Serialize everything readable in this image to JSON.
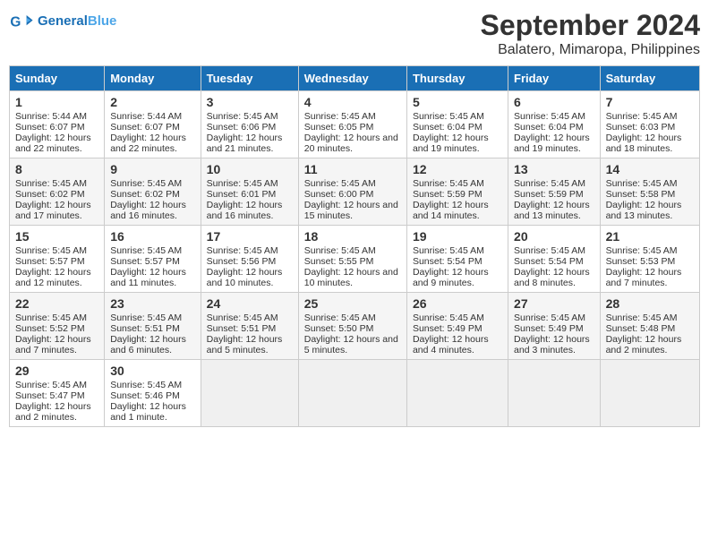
{
  "header": {
    "logo_text_general": "General",
    "logo_text_blue": "Blue",
    "title": "September 2024",
    "subtitle": "Balatero, Mimaropa, Philippines"
  },
  "calendar": {
    "days_of_week": [
      "Sunday",
      "Monday",
      "Tuesday",
      "Wednesday",
      "Thursday",
      "Friday",
      "Saturday"
    ],
    "weeks": [
      [
        {
          "day": "",
          "empty": true
        },
        {
          "day": "",
          "empty": true
        },
        {
          "day": "",
          "empty": true
        },
        {
          "day": "",
          "empty": true
        },
        {
          "day": "",
          "empty": true
        },
        {
          "day": "",
          "empty": true
        },
        {
          "day": "",
          "empty": true
        }
      ],
      [
        {
          "day": "1",
          "sunrise": "Sunrise: 5:44 AM",
          "sunset": "Sunset: 6:07 PM",
          "daylight": "Daylight: 12 hours and 22 minutes."
        },
        {
          "day": "2",
          "sunrise": "Sunrise: 5:44 AM",
          "sunset": "Sunset: 6:07 PM",
          "daylight": "Daylight: 12 hours and 22 minutes."
        },
        {
          "day": "3",
          "sunrise": "Sunrise: 5:45 AM",
          "sunset": "Sunset: 6:06 PM",
          "daylight": "Daylight: 12 hours and 21 minutes."
        },
        {
          "day": "4",
          "sunrise": "Sunrise: 5:45 AM",
          "sunset": "Sunset: 6:05 PM",
          "daylight": "Daylight: 12 hours and 20 minutes."
        },
        {
          "day": "5",
          "sunrise": "Sunrise: 5:45 AM",
          "sunset": "Sunset: 6:04 PM",
          "daylight": "Daylight: 12 hours and 19 minutes."
        },
        {
          "day": "6",
          "sunrise": "Sunrise: 5:45 AM",
          "sunset": "Sunset: 6:04 PM",
          "daylight": "Daylight: 12 hours and 19 minutes."
        },
        {
          "day": "7",
          "sunrise": "Sunrise: 5:45 AM",
          "sunset": "Sunset: 6:03 PM",
          "daylight": "Daylight: 12 hours and 18 minutes."
        }
      ],
      [
        {
          "day": "8",
          "sunrise": "Sunrise: 5:45 AM",
          "sunset": "Sunset: 6:02 PM",
          "daylight": "Daylight: 12 hours and 17 minutes."
        },
        {
          "day": "9",
          "sunrise": "Sunrise: 5:45 AM",
          "sunset": "Sunset: 6:02 PM",
          "daylight": "Daylight: 12 hours and 16 minutes."
        },
        {
          "day": "10",
          "sunrise": "Sunrise: 5:45 AM",
          "sunset": "Sunset: 6:01 PM",
          "daylight": "Daylight: 12 hours and 16 minutes."
        },
        {
          "day": "11",
          "sunrise": "Sunrise: 5:45 AM",
          "sunset": "Sunset: 6:00 PM",
          "daylight": "Daylight: 12 hours and 15 minutes."
        },
        {
          "day": "12",
          "sunrise": "Sunrise: 5:45 AM",
          "sunset": "Sunset: 5:59 PM",
          "daylight": "Daylight: 12 hours and 14 minutes."
        },
        {
          "day": "13",
          "sunrise": "Sunrise: 5:45 AM",
          "sunset": "Sunset: 5:59 PM",
          "daylight": "Daylight: 12 hours and 13 minutes."
        },
        {
          "day": "14",
          "sunrise": "Sunrise: 5:45 AM",
          "sunset": "Sunset: 5:58 PM",
          "daylight": "Daylight: 12 hours and 13 minutes."
        }
      ],
      [
        {
          "day": "15",
          "sunrise": "Sunrise: 5:45 AM",
          "sunset": "Sunset: 5:57 PM",
          "daylight": "Daylight: 12 hours and 12 minutes."
        },
        {
          "day": "16",
          "sunrise": "Sunrise: 5:45 AM",
          "sunset": "Sunset: 5:57 PM",
          "daylight": "Daylight: 12 hours and 11 minutes."
        },
        {
          "day": "17",
          "sunrise": "Sunrise: 5:45 AM",
          "sunset": "Sunset: 5:56 PM",
          "daylight": "Daylight: 12 hours and 10 minutes."
        },
        {
          "day": "18",
          "sunrise": "Sunrise: 5:45 AM",
          "sunset": "Sunset: 5:55 PM",
          "daylight": "Daylight: 12 hours and 10 minutes."
        },
        {
          "day": "19",
          "sunrise": "Sunrise: 5:45 AM",
          "sunset": "Sunset: 5:54 PM",
          "daylight": "Daylight: 12 hours and 9 minutes."
        },
        {
          "day": "20",
          "sunrise": "Sunrise: 5:45 AM",
          "sunset": "Sunset: 5:54 PM",
          "daylight": "Daylight: 12 hours and 8 minutes."
        },
        {
          "day": "21",
          "sunrise": "Sunrise: 5:45 AM",
          "sunset": "Sunset: 5:53 PM",
          "daylight": "Daylight: 12 hours and 7 minutes."
        }
      ],
      [
        {
          "day": "22",
          "sunrise": "Sunrise: 5:45 AM",
          "sunset": "Sunset: 5:52 PM",
          "daylight": "Daylight: 12 hours and 7 minutes."
        },
        {
          "day": "23",
          "sunrise": "Sunrise: 5:45 AM",
          "sunset": "Sunset: 5:51 PM",
          "daylight": "Daylight: 12 hours and 6 minutes."
        },
        {
          "day": "24",
          "sunrise": "Sunrise: 5:45 AM",
          "sunset": "Sunset: 5:51 PM",
          "daylight": "Daylight: 12 hours and 5 minutes."
        },
        {
          "day": "25",
          "sunrise": "Sunrise: 5:45 AM",
          "sunset": "Sunset: 5:50 PM",
          "daylight": "Daylight: 12 hours and 5 minutes."
        },
        {
          "day": "26",
          "sunrise": "Sunrise: 5:45 AM",
          "sunset": "Sunset: 5:49 PM",
          "daylight": "Daylight: 12 hours and 4 minutes."
        },
        {
          "day": "27",
          "sunrise": "Sunrise: 5:45 AM",
          "sunset": "Sunset: 5:49 PM",
          "daylight": "Daylight: 12 hours and 3 minutes."
        },
        {
          "day": "28",
          "sunrise": "Sunrise: 5:45 AM",
          "sunset": "Sunset: 5:48 PM",
          "daylight": "Daylight: 12 hours and 2 minutes."
        }
      ],
      [
        {
          "day": "29",
          "sunrise": "Sunrise: 5:45 AM",
          "sunset": "Sunset: 5:47 PM",
          "daylight": "Daylight: 12 hours and 2 minutes."
        },
        {
          "day": "30",
          "sunrise": "Sunrise: 5:45 AM",
          "sunset": "Sunset: 5:46 PM",
          "daylight": "Daylight: 12 hours and 1 minute."
        },
        {
          "day": "",
          "empty": true
        },
        {
          "day": "",
          "empty": true
        },
        {
          "day": "",
          "empty": true
        },
        {
          "day": "",
          "empty": true
        },
        {
          "day": "",
          "empty": true
        }
      ]
    ]
  }
}
